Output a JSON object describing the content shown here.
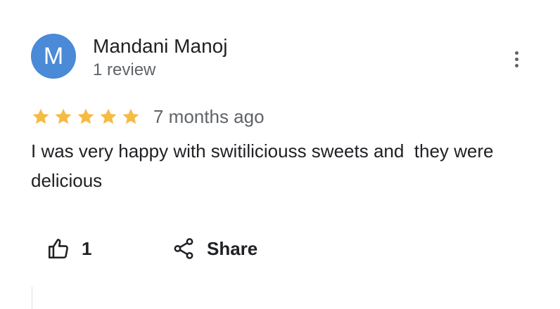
{
  "reviewer": {
    "avatar_letter": "M",
    "avatar_color": "#4a8ad6",
    "name": "Mandani Manoj",
    "review_count": "1 review"
  },
  "more_menu": {
    "icon": "more-vert-icon"
  },
  "rating": {
    "stars_filled": 5,
    "stars_total": 5,
    "star_color": "#f6bb42",
    "time_ago": "7 months ago"
  },
  "review": {
    "text": "I was very happy with switiliciouss sweets and  they were delicious"
  },
  "actions": {
    "like": {
      "icon": "thumbs-up-icon",
      "count": "1"
    },
    "share": {
      "icon": "share-icon",
      "label": "Share"
    }
  }
}
